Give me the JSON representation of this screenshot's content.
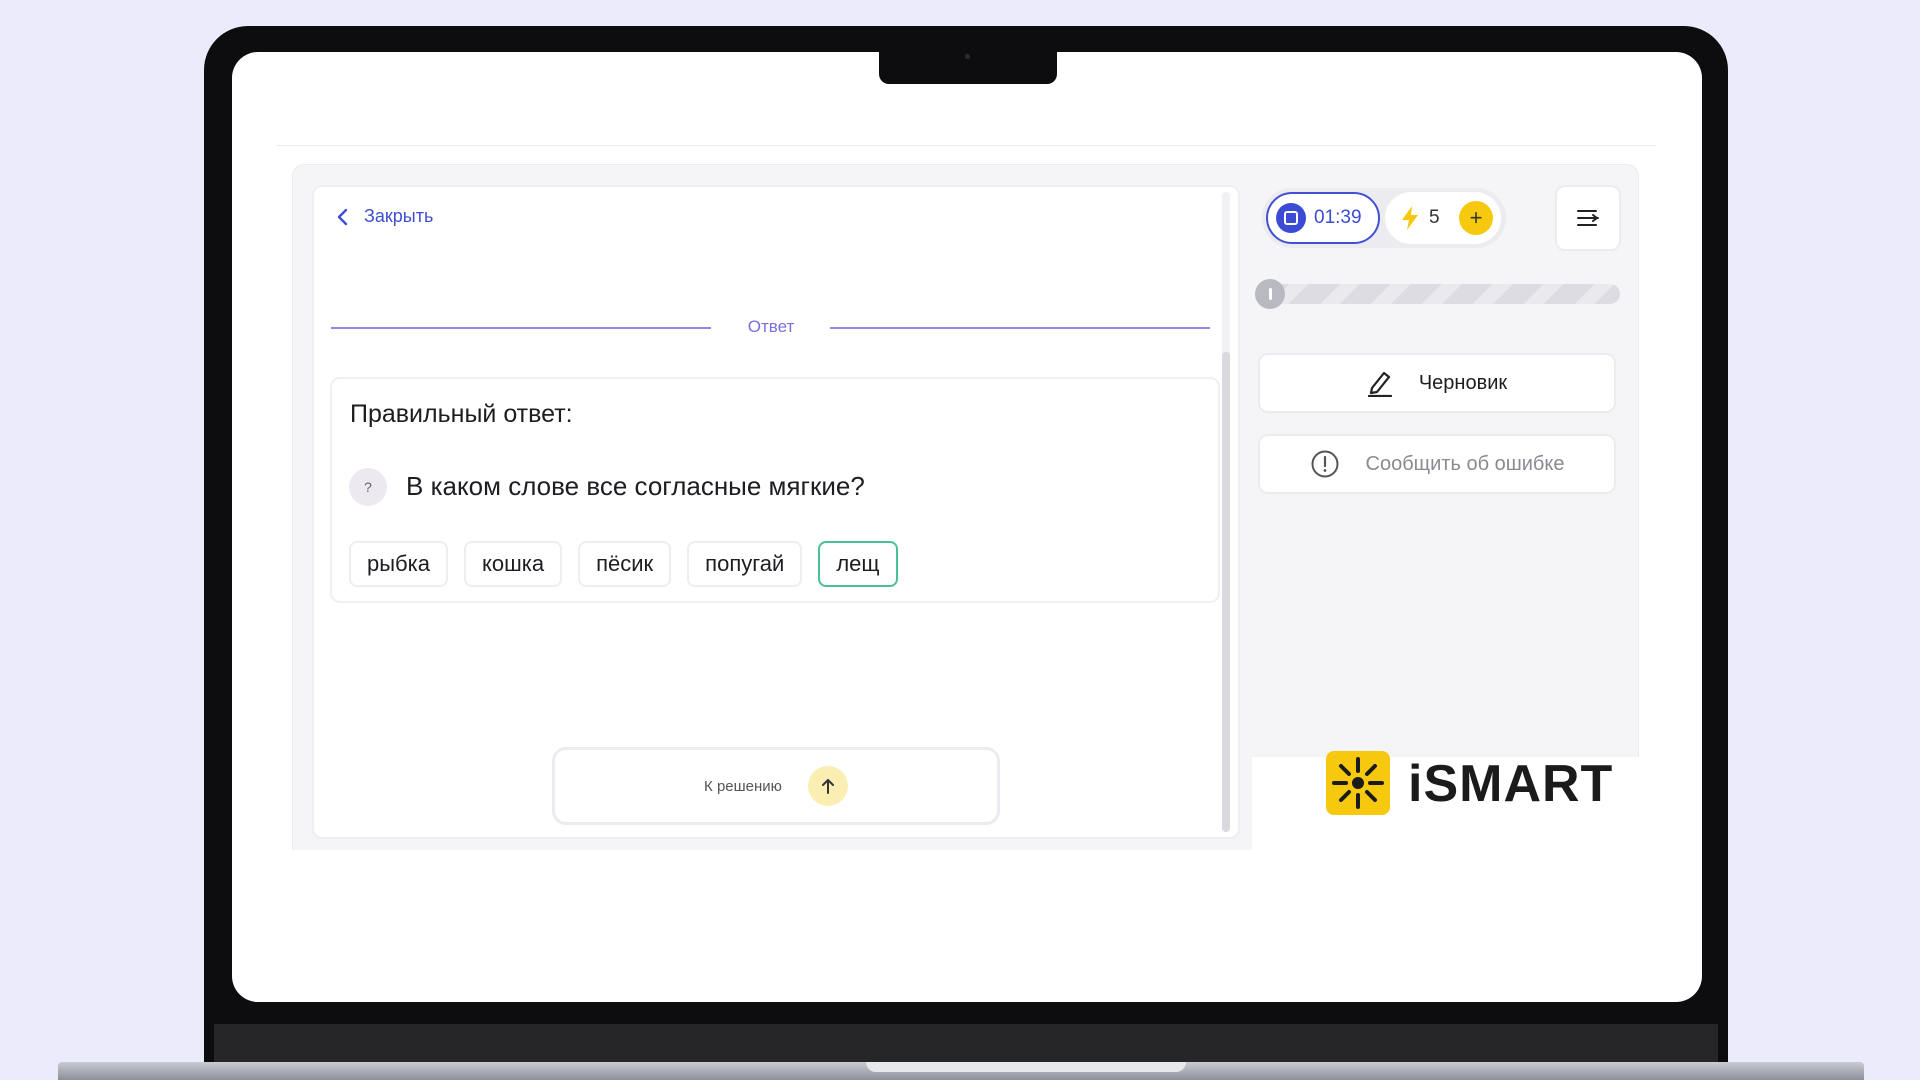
{
  "header": {
    "close_label": "Закрыть"
  },
  "section": {
    "divider_label": "Ответ"
  },
  "answer": {
    "title": "Правильный ответ:",
    "badge": "?",
    "question": "В каком слове все согласные мягкие?",
    "options": [
      {
        "label": "рыбка",
        "correct": false
      },
      {
        "label": "кошка",
        "correct": false
      },
      {
        "label": "пёсик",
        "correct": false
      },
      {
        "label": "попугай",
        "correct": false
      },
      {
        "label": "лещ",
        "correct": true
      }
    ]
  },
  "footer": {
    "to_solution_label": "К решению"
  },
  "sidebar": {
    "timer": "01:39",
    "energy_count": "5",
    "plus_label": "+",
    "progress_fraction": 0.0,
    "draft_label": "Черновик",
    "report_label": "Сообщить об ошибке"
  },
  "brand": {
    "logo_text": "iSMART"
  },
  "colors": {
    "accent": "#3b4bd6",
    "divider": "#8e87e6",
    "correct_border": "#4bbf98",
    "energy": "#f6c90e",
    "background": "#ecebfb"
  },
  "icons": [
    "chevron-left-icon",
    "stop-icon",
    "lightning-icon",
    "plus-icon",
    "menu-icon",
    "pencil-icon",
    "alert-circle-icon",
    "arrow-up-icon",
    "ismart-sun-logo"
  ]
}
